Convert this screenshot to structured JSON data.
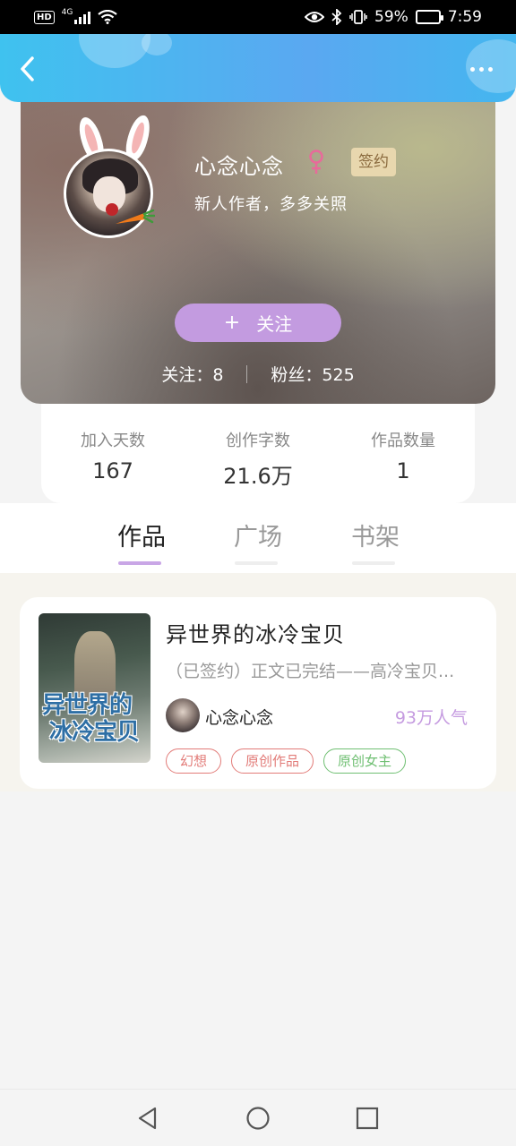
{
  "status_bar": {
    "hd": "HD",
    "network": "4G",
    "battery": "59%",
    "battery_level": 0.59,
    "time": "7:59"
  },
  "header": {
    "back_icon": "chevron-left-icon",
    "more_icon": "more-dots-icon"
  },
  "profile": {
    "name": "心念心念",
    "gender_icon": "female-icon",
    "signed_badge": "签约",
    "bio": "新人作者，多多关照",
    "follow_plus": "+",
    "follow_label": "关注",
    "following": "关注：8",
    "fans": "粉丝：525",
    "colors": {
      "follow_button": "#c39be0",
      "gender": "#e86a9a"
    }
  },
  "stats": [
    {
      "label": "加入天数",
      "value": "167"
    },
    {
      "label": "创作字数",
      "value": "21.6万"
    },
    {
      "label": "作品数量",
      "value": "1"
    }
  ],
  "tabs": [
    {
      "label": "作品",
      "active": true
    },
    {
      "label": "广场",
      "active": false
    },
    {
      "label": "书架",
      "active": false
    }
  ],
  "colors": {
    "tab_underline_active": "#c9a6e6",
    "tab_underline_inactive": "#eeeeee",
    "header_gradient_start": "#3fc2ef",
    "header_gradient_end": "#5aa8f1"
  },
  "book": {
    "cover_title_line1": "异世界的",
    "cover_title_line2": "冰冷宝贝",
    "title": "异世界的冰冷宝贝",
    "description": "（已签约）正文已完结——高冷宝贝...",
    "author": "心念心念",
    "popularity": "93万人气",
    "tags": [
      {
        "label": "幻想",
        "color": "#e27b78"
      },
      {
        "label": "原创作品",
        "color": "#e27b78"
      },
      {
        "label": "原创女主",
        "color": "#6fbf72"
      }
    ]
  },
  "nav_bar": {
    "back_icon": "triangle-back-icon",
    "home_icon": "circle-home-icon",
    "recents_icon": "square-recents-icon"
  }
}
